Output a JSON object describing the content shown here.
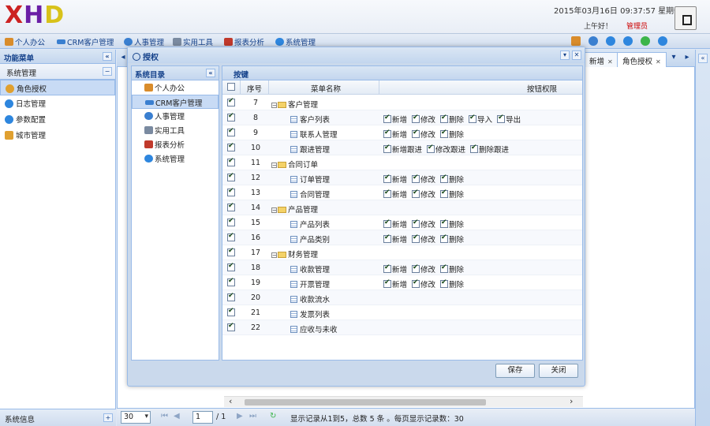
{
  "header": {
    "logo": [
      "X",
      "H",
      "D"
    ],
    "datetime": "2015年03月16日 09:37:57 星期一",
    "greeting": "上午好！",
    "user": "管理员"
  },
  "topnav": {
    "items": [
      {
        "label": "个人办公",
        "icon": "house-icon",
        "color": "#d98c2b"
      },
      {
        "label": "CRM客户管理",
        "icon": "card-icon",
        "color": "#3a7fd0"
      },
      {
        "label": "人事管理",
        "icon": "person-icon",
        "color": "#3a7fd0"
      },
      {
        "label": "实用工具",
        "icon": "tools-icon",
        "color": "#7a8aa0"
      },
      {
        "label": "报表分析",
        "icon": "chart-icon",
        "color": "#c0392b"
      },
      {
        "label": "系统管理",
        "icon": "gear-icon",
        "color": "#2e86de"
      }
    ]
  },
  "left": {
    "title": "功能菜单",
    "collapse": "«",
    "section": "系统管理",
    "section_toggle": "−",
    "items": [
      {
        "label": "角色授权",
        "icon": "group-icon",
        "color": "#e0a030"
      },
      {
        "label": "日志管理",
        "icon": "info-icon",
        "color": "#2e86de"
      },
      {
        "label": "参数配置",
        "icon": "settings-icon",
        "color": "#2e86de"
      },
      {
        "label": "城市管理",
        "icon": "home-icon",
        "color": "#e0a030"
      }
    ],
    "footer": "系统信息",
    "footer_toggle": "+"
  },
  "tabs": [
    {
      "label": "新增"
    },
    {
      "label": "角色授权"
    }
  ],
  "pager": {
    "page_size": "30",
    "page": "1",
    "total": "/ 1",
    "summary": "显示记录从1到5，总数 5 条 。每页显示记录数：30"
  },
  "dialog": {
    "title": "授权",
    "dir_title": "系统目录",
    "dir_collapse": "«",
    "dir_items": [
      {
        "label": "个人办公",
        "icon": "house-icon",
        "color": "#d98c2b"
      },
      {
        "label": "CRM客户管理",
        "icon": "card-icon",
        "color": "#3a7fd0"
      },
      {
        "label": "人事管理",
        "icon": "person-icon",
        "color": "#3a7fd0"
      },
      {
        "label": "实用工具",
        "icon": "tools-icon",
        "color": "#7a8aa0"
      },
      {
        "label": "报表分析",
        "icon": "chart-icon",
        "color": "#c0392b"
      },
      {
        "label": "系统管理",
        "icon": "gear-icon",
        "color": "#2e86de"
      }
    ],
    "key_title": "按键",
    "columns": {
      "seq": "序号",
      "name": "菜单名称",
      "perm": "按钮权限"
    },
    "rows": [
      {
        "seq": "7",
        "name": "客户管理",
        "folder": true,
        "perms": []
      },
      {
        "seq": "8",
        "name": "客户列表",
        "folder": false,
        "perms": [
          "新增",
          "修改",
          "删除",
          "导入",
          "导出"
        ]
      },
      {
        "seq": "9",
        "name": "联系人管理",
        "folder": false,
        "perms": [
          "新增",
          "修改",
          "删除"
        ]
      },
      {
        "seq": "10",
        "name": "跟进管理",
        "folder": false,
        "perms": [
          "新增跟进",
          "修改跟进",
          "删除跟进"
        ]
      },
      {
        "seq": "11",
        "name": "合同订单",
        "folder": true,
        "perms": []
      },
      {
        "seq": "12",
        "name": "订单管理",
        "folder": false,
        "perms": [
          "新增",
          "修改",
          "删除"
        ]
      },
      {
        "seq": "13",
        "name": "合同管理",
        "folder": false,
        "perms": [
          "新增",
          "修改",
          "删除"
        ]
      },
      {
        "seq": "14",
        "name": "产品管理",
        "folder": true,
        "perms": []
      },
      {
        "seq": "15",
        "name": "产品列表",
        "folder": false,
        "perms": [
          "新增",
          "修改",
          "删除"
        ]
      },
      {
        "seq": "16",
        "name": "产品类别",
        "folder": false,
        "perms": [
          "新增",
          "修改",
          "删除"
        ]
      },
      {
        "seq": "17",
        "name": "财务管理",
        "folder": true,
        "perms": []
      },
      {
        "seq": "18",
        "name": "收款管理",
        "folder": false,
        "perms": [
          "新增",
          "修改",
          "删除"
        ]
      },
      {
        "seq": "19",
        "name": "开票管理",
        "folder": false,
        "perms": [
          "新增",
          "修改",
          "删除"
        ]
      },
      {
        "seq": "20",
        "name": "收款流水",
        "folder": false,
        "perms": []
      },
      {
        "seq": "21",
        "name": "发票列表",
        "folder": false,
        "perms": []
      },
      {
        "seq": "22",
        "name": "应收与未收",
        "folder": false,
        "perms": []
      }
    ],
    "save": "保存",
    "close": "关闭"
  }
}
